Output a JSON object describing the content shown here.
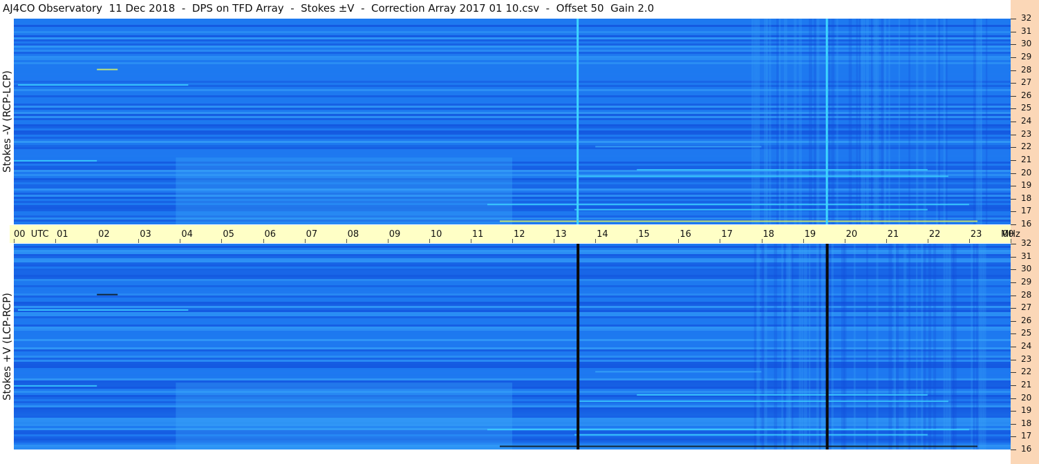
{
  "title": "AJ4CO Observatory  11 Dec 2018  -  DPS on TFD Array  -  Stokes ±V  -  Correction Array 2017 01 10.csv  -  Offset 50  Gain 2.0",
  "colors": {
    "background_blue": "#1e79f0",
    "band_dark_blue": "#0f47d8",
    "band_light_blue": "#3aa6f8",
    "cyan": "#3ed6ff",
    "yellow": "#e8ff5a",
    "peach": "#fbd7b7",
    "time_bar": "#ffffc6",
    "black": "#0a0a0a"
  },
  "chart_data": [
    {
      "type": "heatmap",
      "title": "",
      "ylabel": "Stokes -V  (RCP-LCP)",
      "xlabel": "",
      "ylim": [
        16,
        32
      ],
      "yticks": [
        "32",
        "31",
        "30",
        "29",
        "28",
        "27",
        "26",
        "25",
        "24",
        "23",
        "22",
        "21",
        "20",
        "19",
        "18",
        "17",
        "16"
      ],
      "vertical_lines": [
        {
          "hour": 13.55,
          "style": "light"
        },
        {
          "hour": 19.55,
          "style": "light"
        }
      ]
    },
    {
      "type": "heatmap",
      "title": "",
      "ylabel": "Stokes +V  (LCP-RCP)",
      "xlabel": "",
      "ylim": [
        16,
        32
      ],
      "yticks": [
        "32",
        "31",
        "30",
        "29",
        "28",
        "27",
        "26",
        "25",
        "24",
        "23",
        "22",
        "21",
        "20",
        "19",
        "18",
        "17",
        "16"
      ],
      "vertical_lines": [
        {
          "hour": 13.55,
          "style": "dark"
        },
        {
          "hour": 19.55,
          "style": "dark"
        }
      ]
    }
  ],
  "time_axis": {
    "xlim": [
      0,
      24
    ],
    "labels": [
      "00  UTC",
      "01",
      "02",
      "03",
      "04",
      "05",
      "06",
      "07",
      "08",
      "09",
      "10",
      "11",
      "12",
      "13",
      "14",
      "15",
      "16",
      "17",
      "18",
      "19",
      "20",
      "21",
      "22",
      "23",
      "00"
    ],
    "unit": "MHz"
  }
}
